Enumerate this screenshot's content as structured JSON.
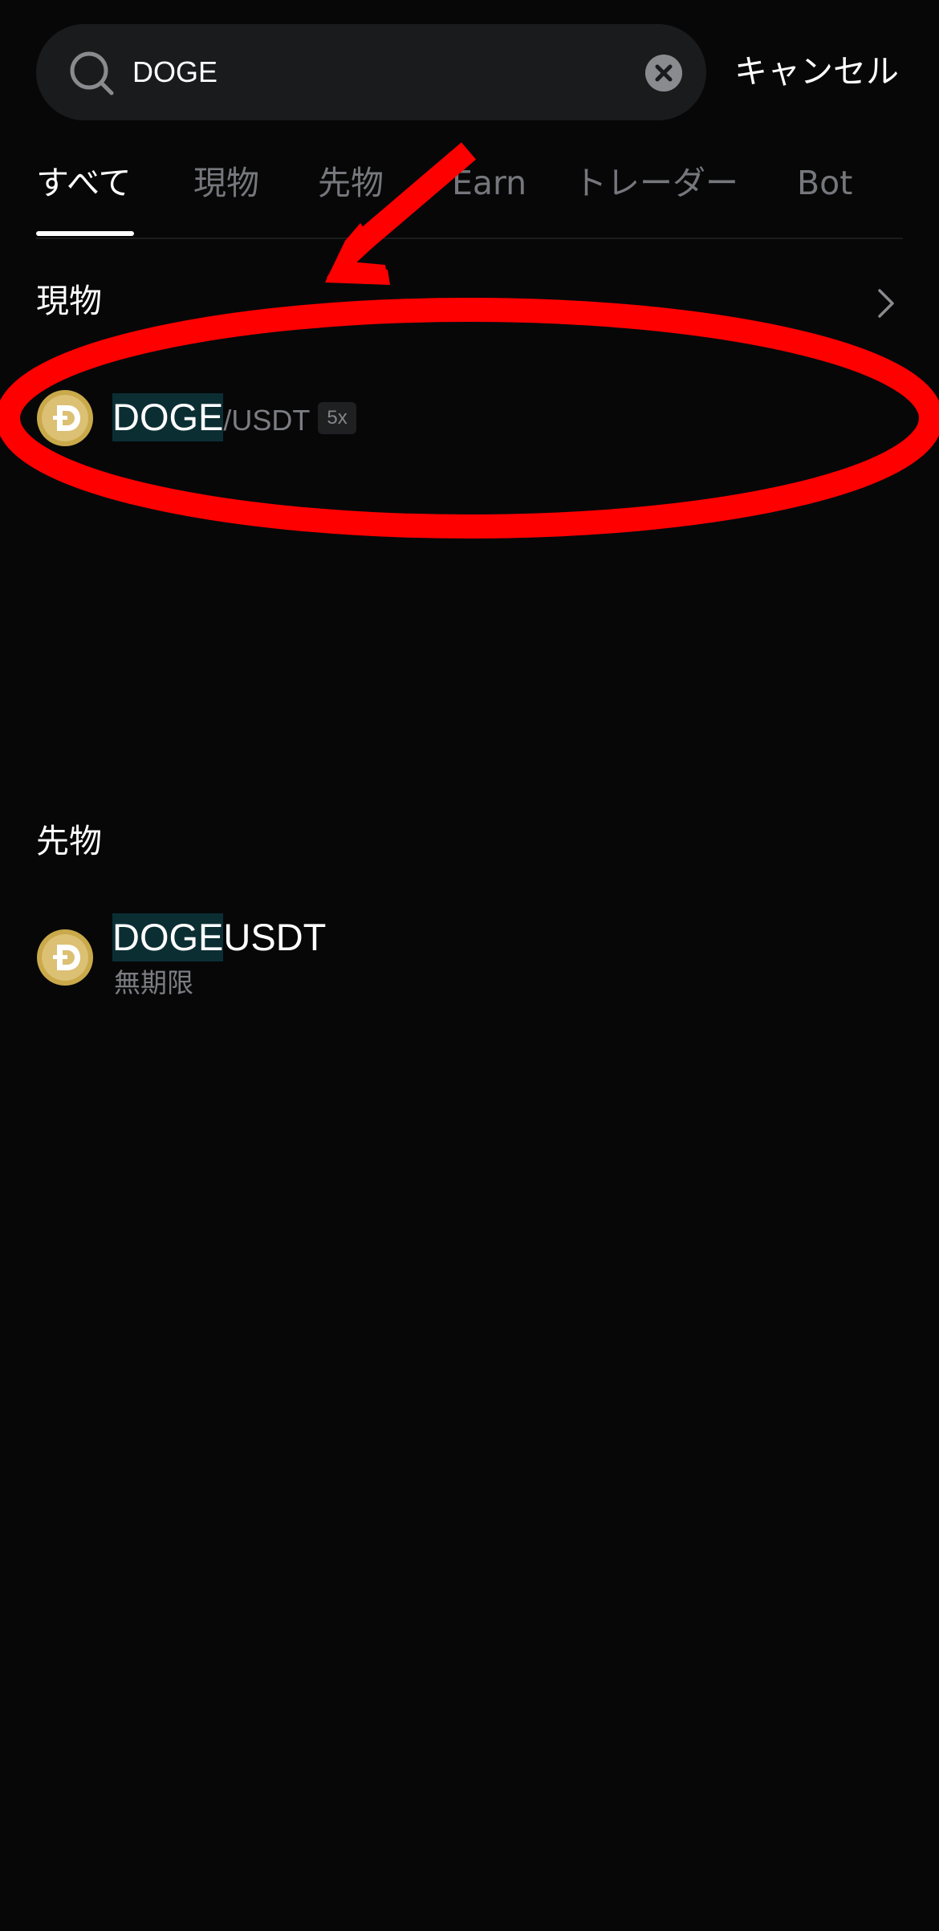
{
  "search": {
    "value": "DOGE",
    "cancel_label": "キャンセル"
  },
  "tabs": [
    {
      "label": "すべて",
      "active": true
    },
    {
      "label": "現物",
      "active": false
    },
    {
      "label": "先物",
      "active": false
    },
    {
      "label": "Earn",
      "active": false
    },
    {
      "label": "トレーダー",
      "active": false
    },
    {
      "label": "Bot",
      "active": false
    }
  ],
  "spot": {
    "title": "現物",
    "items": [
      {
        "base": "DOGE",
        "quote": "/USDT",
        "leverage": "5x",
        "icon": "dogecoin-logo-icon"
      }
    ]
  },
  "futures": {
    "title": "先物",
    "items": [
      {
        "base_highlight": "DOGE",
        "base_rest": "USDT",
        "type": "無期限",
        "icon": "dogecoin-logo-icon"
      }
    ]
  },
  "colors": {
    "background": "#070708",
    "search_bg": "#1a1b1d",
    "highlight": "#0b2e33",
    "muted_text": "#76777c",
    "annotation_red": "#ff0000"
  },
  "icons": {
    "search": "search-icon",
    "clear": "clear-icon",
    "chevron": "chevron-right-icon"
  }
}
